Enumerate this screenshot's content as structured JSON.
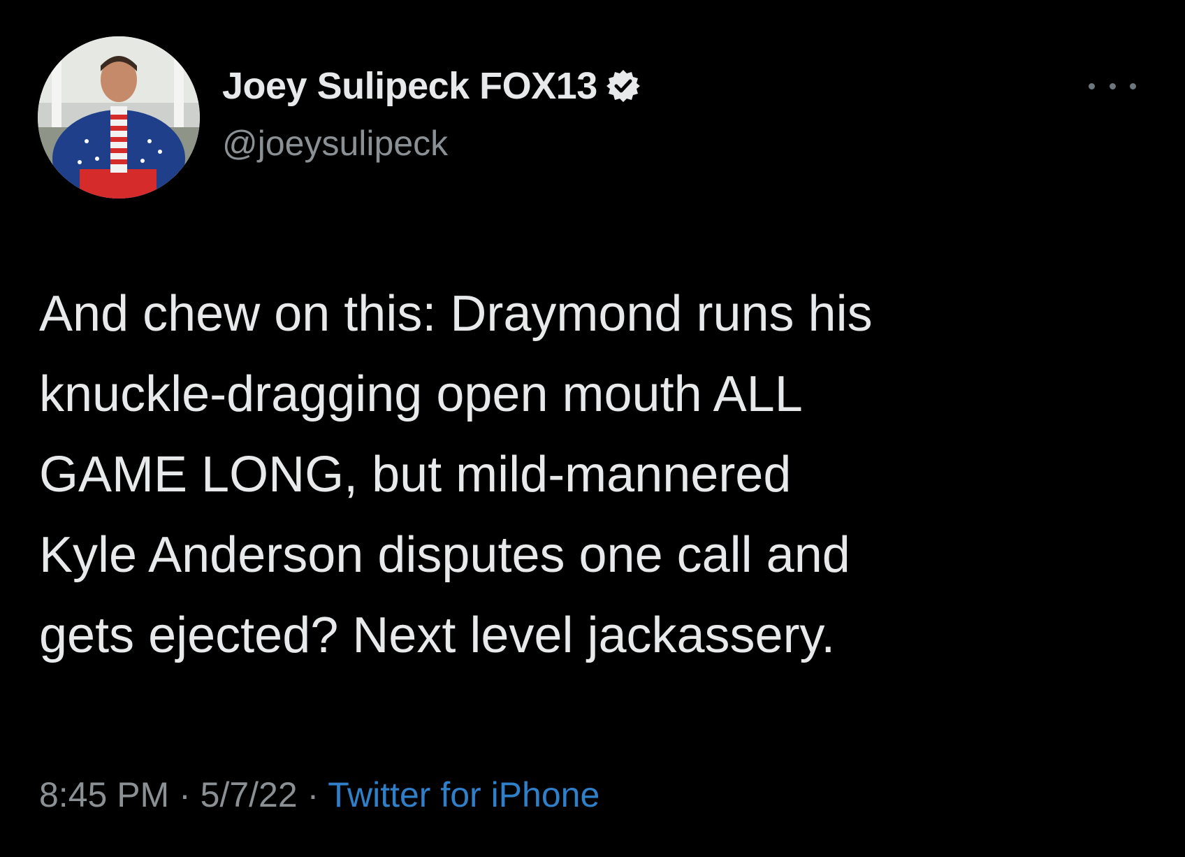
{
  "author": {
    "display_name": "Joey Sulipeck FOX13",
    "handle": "@joeysulipeck",
    "verified": true,
    "verified_color": "#e7e9ea"
  },
  "menu": {
    "icon": "more-horizontal-icon"
  },
  "tweet": {
    "lines": [
      "And chew on this:  Draymond runs his",
      "knuckle-dragging open mouth ALL",
      "GAME LONG, but mild-mannered",
      "Kyle Anderson disputes one call and",
      "gets ejected?  Next level jackassery."
    ]
  },
  "meta": {
    "time": "8:45 PM",
    "separator": " · ",
    "date": "5/7/22",
    "source": "Twitter for iPhone",
    "source_color": "#2f7fc9"
  }
}
